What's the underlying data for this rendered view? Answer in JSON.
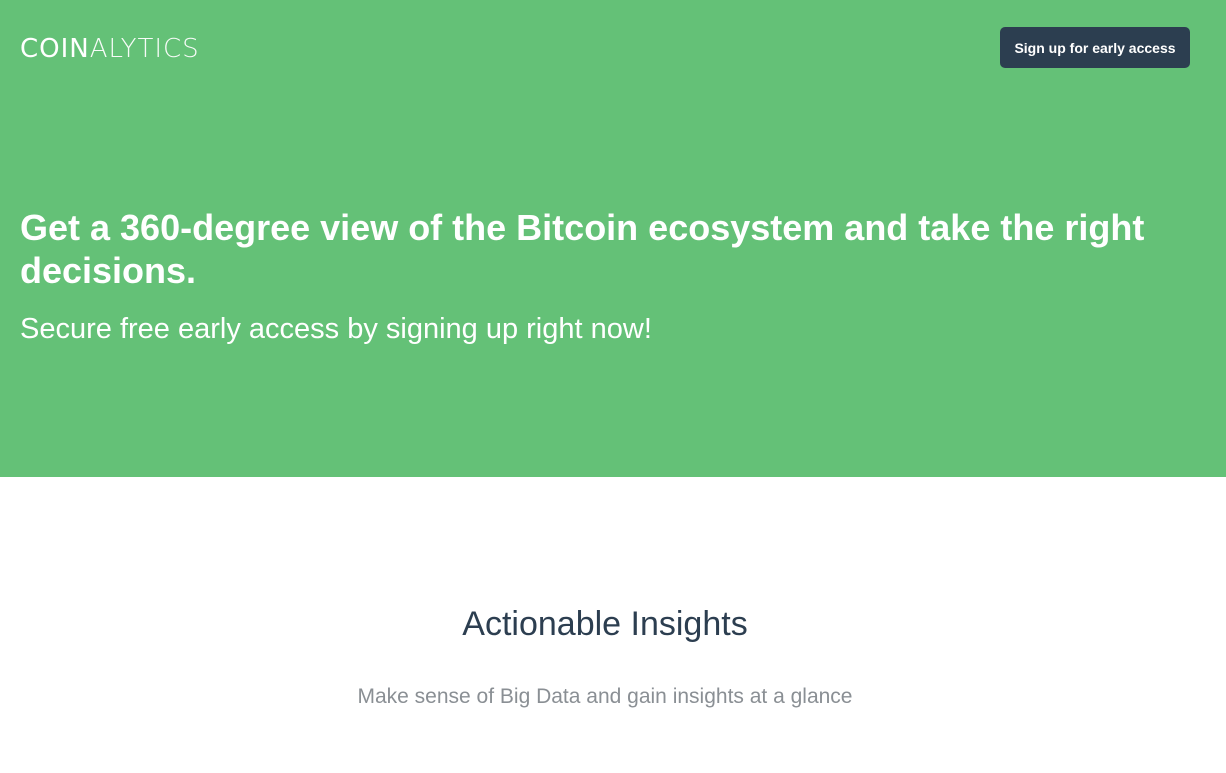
{
  "header": {
    "logo_bold": "COIN",
    "logo_light": "ALYTICS",
    "signup_label": "Sign up for early access"
  },
  "hero": {
    "headline": "Get a 360-degree view of the Bitcoin ecosystem and take the right decisions.",
    "subline": "Secure free early access by signing up right now!"
  },
  "features": {
    "title": "Actionable Insights",
    "subtitle": "Make sense of Big Data and gain insights at a glance"
  },
  "colors": {
    "hero_background": "#64c177",
    "button_background": "#2c3e50",
    "title_text": "#2c3e50",
    "subtitle_text": "#8a8f94"
  }
}
